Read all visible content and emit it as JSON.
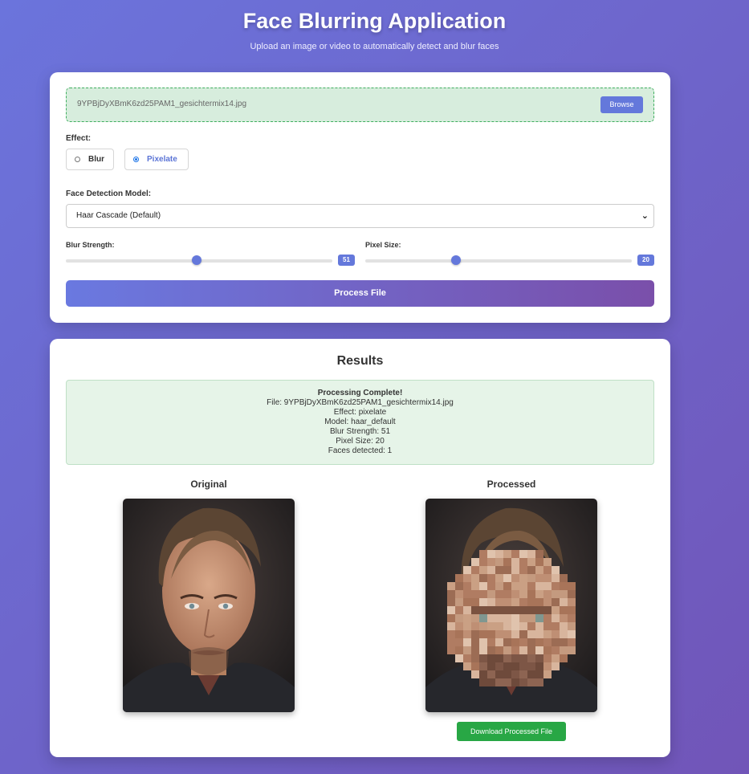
{
  "header": {
    "title": "Face Blurring Application",
    "subtitle": "Upload an image or video to automatically detect and blur faces"
  },
  "upload": {
    "filename": "9YPBjDyXBmK6zd25PAM1_gesichtermix14.jpg",
    "browse_label": "Browse"
  },
  "effect": {
    "label": "Effect:",
    "options": [
      {
        "label": "Blur",
        "selected": false
      },
      {
        "label": "Pixelate",
        "selected": true
      }
    ]
  },
  "model": {
    "label": "Face Detection Model:",
    "selected": "Haar Cascade (Default)"
  },
  "sliders": {
    "blur": {
      "label": "Blur Strength:",
      "value": "51",
      "fraction": 0.49
    },
    "pixel": {
      "label": "Pixel Size:",
      "value": "20",
      "fraction": 0.34
    }
  },
  "process_label": "Process File",
  "results": {
    "title": "Results",
    "status_head": "Processing Complete!",
    "lines": [
      "File: 9YPBjDyXBmK6zd25PAM1_gesichtermix14.jpg",
      "Effect: pixelate",
      "Model: haar_default",
      "Blur Strength: 51",
      "Pixel Size: 20",
      "Faces detected: 1"
    ],
    "original_label": "Original",
    "processed_label": "Processed",
    "download_label": "Download Processed File"
  },
  "colors": {
    "accent": "#6478db",
    "success": "#28a745",
    "gradient_start": "#6b74dc",
    "gradient_end": "#7155b8"
  },
  "icons": {
    "select_chevron": "chevron-down-icon"
  }
}
